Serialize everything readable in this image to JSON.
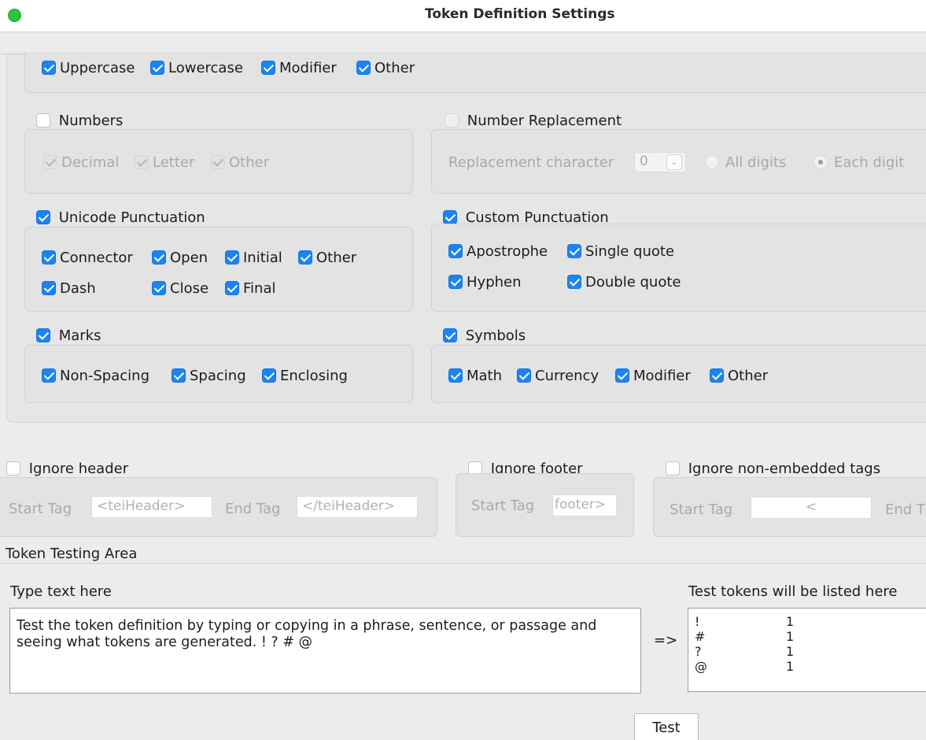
{
  "window": {
    "title": "Token Definition Settings"
  },
  "letters": {
    "items": [
      {
        "label": "Uppercase",
        "checked": true
      },
      {
        "label": "Lowercase",
        "checked": true
      },
      {
        "label": "Modifier",
        "checked": true
      },
      {
        "label": "Other",
        "checked": true
      }
    ]
  },
  "numbers": {
    "label": "Numbers",
    "checked": false,
    "items": [
      {
        "label": "Decimal",
        "checked": true,
        "disabled": true
      },
      {
        "label": "Letter",
        "checked": true,
        "disabled": true
      },
      {
        "label": "Other",
        "checked": true,
        "disabled": true
      }
    ]
  },
  "number_replacement": {
    "label": "Number Replacement",
    "checked": false,
    "disabled": true,
    "char_label": "Replacement character",
    "char_value": "0",
    "radio_all": "All digits",
    "radio_each": "Each digit",
    "selected": "Each digit"
  },
  "unicode_punctuation": {
    "label": "Unicode Punctuation",
    "checked": true,
    "row1": [
      "Connector",
      "Open",
      "Initial",
      "Other"
    ],
    "row2": [
      "Dash",
      "Close",
      "Final"
    ]
  },
  "custom_punctuation": {
    "label": "Custom Punctuation",
    "checked": true,
    "row1": [
      "Apostrophe",
      "Single quote"
    ],
    "row2": [
      "Hyphen",
      "Double quote"
    ]
  },
  "marks": {
    "label": "Marks",
    "checked": true,
    "items": [
      "Non-Spacing",
      "Spacing",
      "Enclosing"
    ]
  },
  "symbols": {
    "label": "Symbols",
    "checked": true,
    "items": [
      "Math",
      "Currency",
      "Modifier",
      "Other"
    ]
  },
  "ignore_header": {
    "label": "Ignore header",
    "checked": false,
    "start_label": "Start Tag",
    "start_value": "<teiHeader>",
    "end_label": "End Tag",
    "end_value": "</teiHeader>"
  },
  "ignore_footer": {
    "label": "Ignore footer",
    "checked": false,
    "start_label": "Start Tag",
    "start_value": "footer>"
  },
  "ignore_tags": {
    "label": "Ignore non-embedded tags",
    "checked": false,
    "start_label": "Start Tag",
    "start_value": "<",
    "end_label": "End T"
  },
  "testing": {
    "section_title": "Token Testing Area",
    "input_label": "Type text here",
    "input_text": "Test the token definition by typing or copying in a phrase, sentence, or passage and seeing what tokens are generated.  ! ? # @",
    "arrow": "=>",
    "output_label": "Test tokens will be listed here",
    "tokens": [
      {
        "token": "!",
        "count": "1"
      },
      {
        "token": "#",
        "count": "1"
      },
      {
        "token": "?",
        "count": "1"
      },
      {
        "token": "@",
        "count": "1"
      }
    ],
    "test_button": "Test"
  }
}
